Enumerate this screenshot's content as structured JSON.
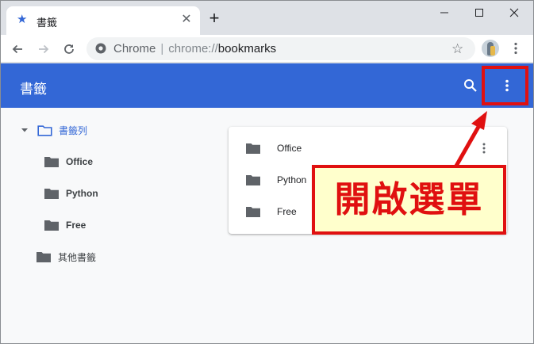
{
  "tab": {
    "title": "書籤",
    "close_glyph": "✕"
  },
  "newtab_glyph": "+",
  "window_controls": [
    "minimize",
    "maximize",
    "close"
  ],
  "omnibox": {
    "site": "Chrome",
    "separator": "|",
    "scheme": "chrome://",
    "path": "bookmarks"
  },
  "app": {
    "title": "書籤"
  },
  "tree": {
    "root": {
      "label": "書籤列",
      "expanded": true
    },
    "children": [
      {
        "label": "Office"
      },
      {
        "label": "Python"
      },
      {
        "label": "Free"
      }
    ],
    "other": {
      "label": "其他書籤"
    }
  },
  "list": [
    {
      "label": "Office"
    },
    {
      "label": "Python"
    },
    {
      "label": "Free"
    }
  ],
  "annotation": {
    "text": "開啟選單"
  },
  "colors": {
    "accent": "#3367d6",
    "highlight": "#e01010",
    "note_bg": "#ffffcc"
  },
  "icons": [
    "star-icon",
    "close-icon",
    "plus-icon",
    "back-icon",
    "forward-icon",
    "reload-icon",
    "chrome-icon",
    "bookmark-star-icon",
    "more-vert-icon",
    "search-icon",
    "folder-icon",
    "folder-open-icon",
    "caret-down-icon"
  ]
}
